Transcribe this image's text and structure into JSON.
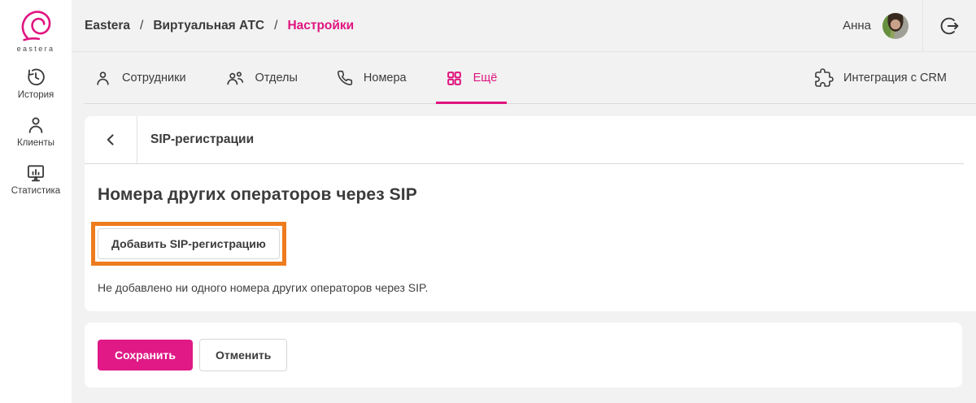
{
  "colors": {
    "brand_pink": "#e0147f",
    "button_pink": "#e01987",
    "highlight_orange": "#ee7b1d"
  },
  "sidebar": {
    "logo_text": "eastera",
    "items": [
      {
        "label": "История",
        "icon": "history-icon"
      },
      {
        "label": "Клиенты",
        "icon": "person-icon"
      },
      {
        "label": "Статистика",
        "icon": "statistics-icon"
      }
    ]
  },
  "header": {
    "breadcrumb": [
      {
        "label": "Eastera"
      },
      {
        "label": "Виртуальная АТС"
      },
      {
        "label": "Настройки"
      }
    ],
    "separator": "/",
    "user_name": "Анна"
  },
  "tabs": {
    "items": [
      {
        "label": "Сотрудники",
        "icon": "employee-icon",
        "active": false
      },
      {
        "label": "Отделы",
        "icon": "departments-icon",
        "active": false
      },
      {
        "label": "Номера",
        "icon": "phone-icon",
        "active": false
      },
      {
        "label": "Ещё",
        "icon": "grid-icon",
        "active": true
      }
    ],
    "crm_label": "Интеграция с CRM"
  },
  "panel": {
    "title": "SIP-регистрации",
    "heading": "Номера других операторов через SIP",
    "add_button_label": "Добавить SIP-регистрацию",
    "empty_text": "Не добавлено ни одного номера других операторов через SIP."
  },
  "footer": {
    "save_label": "Сохранить",
    "cancel_label": "Отменить"
  }
}
